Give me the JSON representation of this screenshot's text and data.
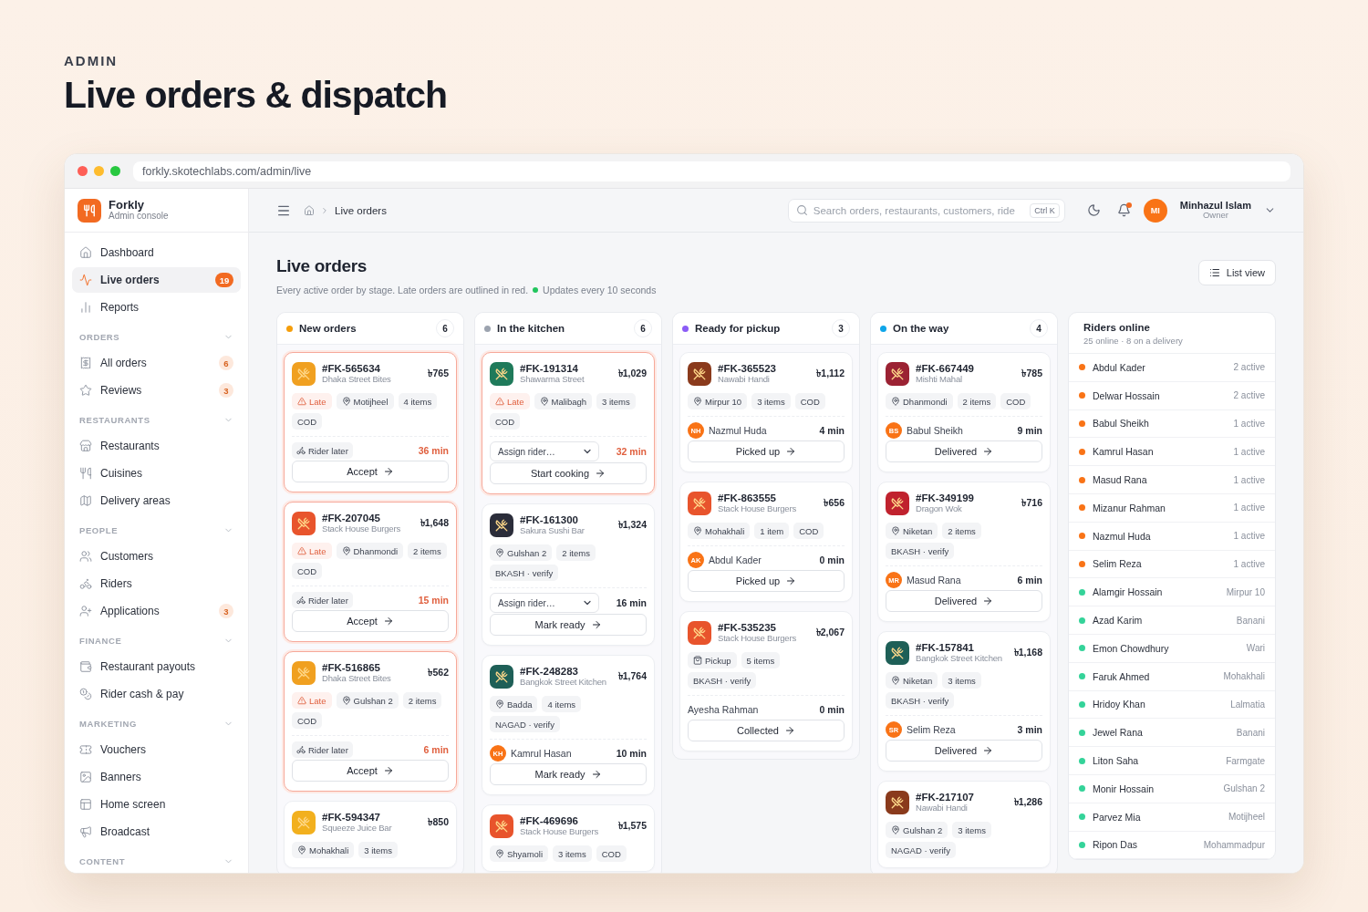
{
  "eyebrow": "ADMIN",
  "headline": "Live orders & dispatch",
  "browser": {
    "url": "forkly.skotechlabs.com/admin/live"
  },
  "sidebar": {
    "brand": {
      "name": "Forkly",
      "subtitle": "Admin console"
    },
    "items": [
      {
        "label": "Dashboard",
        "selected": false
      },
      {
        "label": "Live orders",
        "selected": true,
        "badge": "19"
      },
      {
        "label": "Reports",
        "selected": false
      }
    ],
    "sections": [
      {
        "title": "ORDERS",
        "items": [
          {
            "label": "All orders",
            "selected": false,
            "badge": "6"
          },
          {
            "label": "Reviews",
            "selected": false,
            "badge": "3"
          }
        ]
      },
      {
        "title": "RESTAURANTS",
        "items": [
          {
            "label": "Restaurants",
            "selected": false
          },
          {
            "label": "Cuisines",
            "selected": false
          },
          {
            "label": "Delivery areas",
            "selected": false
          }
        ]
      },
      {
        "title": "PEOPLE",
        "items": [
          {
            "label": "Customers",
            "selected": false
          },
          {
            "label": "Riders",
            "selected": false
          },
          {
            "label": "Applications",
            "selected": false,
            "badge": "3"
          }
        ]
      },
      {
        "title": "FINANCE",
        "items": [
          {
            "label": "Restaurant payouts",
            "selected": false
          },
          {
            "label": "Rider cash & pay",
            "selected": false
          }
        ]
      },
      {
        "title": "MARKETING",
        "items": [
          {
            "label": "Vouchers",
            "selected": false
          },
          {
            "label": "Banners",
            "selected": false
          },
          {
            "label": "Home screen",
            "selected": false
          },
          {
            "label": "Broadcast",
            "selected": false
          }
        ]
      },
      {
        "title": "CONTENT"
      }
    ]
  },
  "topbar": {
    "breadcrumb": "Live orders",
    "search": {
      "placeholder": "Search orders, restaurants, customers, ride",
      "shortcut": "Ctrl K"
    },
    "notifications_unread": true,
    "user": {
      "initials": "MI",
      "name": "Minhazul Islam",
      "role": "Owner"
    }
  },
  "page": {
    "title": "Live orders",
    "subtitle": "Every active order by stage. Late orders are outlined in red.",
    "live_note": "Updates every 10 seconds",
    "view_button": "List view"
  },
  "columns": [
    {
      "title": "New orders",
      "count": "6",
      "color": "#f59e0b",
      "cards": [
        {
          "id": "#FK-565634",
          "restaurant": "Dhaka Street Bites",
          "amount": "৳765",
          "color": "#f0a020",
          "late": true,
          "tags": [
            {
              "kind": "late",
              "label": "Late"
            },
            {
              "kind": "area",
              "label": "Motijheel"
            },
            {
              "kind": "plain",
              "label": "4 items"
            },
            {
              "kind": "plain",
              "label": "COD"
            }
          ],
          "rider": {
            "kind": "later",
            "label": "Rider later"
          },
          "time": "36 min",
          "action": "Accept"
        },
        {
          "id": "#FK-207045",
          "restaurant": "Stack House Burgers",
          "amount": "৳1,648",
          "color": "#e8542c",
          "late": true,
          "tags": [
            {
              "kind": "late",
              "label": "Late"
            },
            {
              "kind": "area",
              "label": "Dhanmondi"
            },
            {
              "kind": "plain",
              "label": "2 items"
            },
            {
              "kind": "plain",
              "label": "COD"
            }
          ],
          "rider": {
            "kind": "later",
            "label": "Rider later"
          },
          "time": "15 min",
          "action": "Accept"
        },
        {
          "id": "#FK-516865",
          "restaurant": "Dhaka Street Bites",
          "amount": "৳562",
          "color": "#f0a020",
          "late": true,
          "tags": [
            {
              "kind": "late",
              "label": "Late"
            },
            {
              "kind": "area",
              "label": "Gulshan 2"
            },
            {
              "kind": "plain",
              "label": "2 items"
            },
            {
              "kind": "plain",
              "label": "COD"
            }
          ],
          "rider": {
            "kind": "later",
            "label": "Rider later"
          },
          "time": "6 min",
          "action": "Accept"
        },
        {
          "id": "#FK-594347",
          "restaurant": "Squeeze Juice Bar",
          "amount": "৳850",
          "color": "#f2b01e",
          "late": false,
          "tags": [
            {
              "kind": "area",
              "label": "Mohakhali"
            },
            {
              "kind": "plain",
              "label": "3 items"
            }
          ]
        }
      ]
    },
    {
      "title": "In the kitchen",
      "count": "6",
      "color": "#9ca3af",
      "cards": [
        {
          "id": "#FK-191314",
          "restaurant": "Shawarma Street",
          "amount": "৳1,029",
          "color": "#1f7a5a",
          "late": true,
          "tags": [
            {
              "kind": "late",
              "label": "Late"
            },
            {
              "kind": "area",
              "label": "Malibagh"
            },
            {
              "kind": "plain",
              "label": "3 items"
            },
            {
              "kind": "plain",
              "label": "COD"
            }
          ],
          "rider": {
            "kind": "select",
            "label": "Assign rider…"
          },
          "time": "32 min",
          "action": "Start cooking"
        },
        {
          "id": "#FK-161300",
          "restaurant": "Sakura Sushi Bar",
          "amount": "৳1,324",
          "color": "#2b2d3a",
          "late": false,
          "tags": [
            {
              "kind": "area",
              "label": "Gulshan 2"
            },
            {
              "kind": "plain",
              "label": "2 items"
            },
            {
              "kind": "plain",
              "label": "BKASH · verify"
            }
          ],
          "rider": {
            "kind": "select",
            "label": "Assign rider…"
          },
          "time": "16 min",
          "action": "Mark ready"
        },
        {
          "id": "#FK-248283",
          "restaurant": "Bangkok Street Kitchen",
          "amount": "৳1,764",
          "color": "#1e5f57",
          "late": false,
          "tags": [
            {
              "kind": "area",
              "label": "Badda"
            },
            {
              "kind": "plain",
              "label": "4 items"
            },
            {
              "kind": "plain",
              "label": "NAGAD · verify"
            }
          ],
          "rider": {
            "kind": "assigned",
            "initials": "KH",
            "name": "Kamrul Hasan"
          },
          "time": "10 min",
          "action": "Mark ready"
        },
        {
          "id": "#FK-469696",
          "restaurant": "Stack House Burgers",
          "amount": "৳1,575",
          "color": "#e8542c",
          "late": false,
          "tags": [
            {
              "kind": "area",
              "label": "Shyamoli"
            },
            {
              "kind": "plain",
              "label": "3 items"
            },
            {
              "kind": "plain",
              "label": "COD"
            }
          ]
        }
      ]
    },
    {
      "title": "Ready for pickup",
      "count": "3",
      "color": "#8b5cf6",
      "cards": [
        {
          "id": "#FK-365523",
          "restaurant": "Nawabi Handi",
          "amount": "৳1,112",
          "color": "#8a3a1c",
          "late": false,
          "tags": [
            {
              "kind": "area",
              "label": "Mirpur 10"
            },
            {
              "kind": "plain",
              "label": "3 items"
            },
            {
              "kind": "plain",
              "label": "COD"
            }
          ],
          "rider": {
            "kind": "assigned",
            "initials": "NH",
            "name": "Nazmul Huda"
          },
          "time": "4 min",
          "action": "Picked up"
        },
        {
          "id": "#FK-863555",
          "restaurant": "Stack House Burgers",
          "amount": "৳656",
          "color": "#e8542c",
          "late": false,
          "tags": [
            {
              "kind": "area",
              "label": "Mohakhali"
            },
            {
              "kind": "plain",
              "label": "1 item"
            },
            {
              "kind": "plain",
              "label": "COD"
            }
          ],
          "rider": {
            "kind": "assigned",
            "initials": "AK",
            "name": "Abdul Kader"
          },
          "time": "0 min",
          "action": "Picked up"
        },
        {
          "id": "#FK-535235",
          "restaurant": "Stack House Burgers",
          "amount": "৳2,067",
          "color": "#e8542c",
          "late": false,
          "tags": [
            {
              "kind": "pickup",
              "label": "Pickup"
            },
            {
              "kind": "plain",
              "label": "5 items"
            },
            {
              "kind": "plain",
              "label": "BKASH · verify"
            }
          ],
          "rider": {
            "kind": "customer",
            "name": "Ayesha Rahman"
          },
          "time": "0 min",
          "action": "Collected"
        }
      ]
    },
    {
      "title": "On the way",
      "count": "4",
      "color": "#0ea5e9",
      "cards": [
        {
          "id": "#FK-667449",
          "restaurant": "Mishti Mahal",
          "amount": "৳785",
          "color": "#9b2233",
          "late": false,
          "tags": [
            {
              "kind": "area",
              "label": "Dhanmondi"
            },
            {
              "kind": "plain",
              "label": "2 items"
            },
            {
              "kind": "plain",
              "label": "COD"
            }
          ],
          "rider": {
            "kind": "assigned",
            "initials": "BS",
            "name": "Babul Sheikh"
          },
          "time": "9 min",
          "action": "Delivered"
        },
        {
          "id": "#FK-349199",
          "restaurant": "Dragon Wok",
          "amount": "৳716",
          "color": "#c0222e",
          "late": false,
          "tags": [
            {
              "kind": "area",
              "label": "Niketan"
            },
            {
              "kind": "plain",
              "label": "2 items"
            },
            {
              "kind": "plain",
              "label": "BKASH · verify"
            }
          ],
          "rider": {
            "kind": "assigned",
            "initials": "MR",
            "name": "Masud Rana"
          },
          "time": "6 min",
          "action": "Delivered"
        },
        {
          "id": "#FK-157841",
          "restaurant": "Bangkok Street Kitchen",
          "amount": "৳1,168",
          "color": "#1e5f57",
          "late": false,
          "tags": [
            {
              "kind": "area",
              "label": "Niketan"
            },
            {
              "kind": "plain",
              "label": "3 items"
            },
            {
              "kind": "plain",
              "label": "BKASH · verify"
            }
          ],
          "rider": {
            "kind": "assigned",
            "initials": "SR",
            "name": "Selim Reza"
          },
          "time": "3 min",
          "action": "Delivered"
        },
        {
          "id": "#FK-217107",
          "restaurant": "Nawabi Handi",
          "amount": "৳1,286",
          "color": "#8a3a1c",
          "late": false,
          "tags": [
            {
              "kind": "area",
              "label": "Gulshan 2"
            },
            {
              "kind": "plain",
              "label": "3 items"
            },
            {
              "kind": "plain",
              "label": "NAGAD · verify"
            }
          ]
        }
      ]
    }
  ],
  "riders": {
    "title": "Riders online",
    "subtitle": "25 online · 8 on a delivery",
    "rows": [
      {
        "name": "Abdul Kader",
        "status": "2 active",
        "color": "#f97316"
      },
      {
        "name": "Delwar Hossain",
        "status": "2 active",
        "color": "#f97316"
      },
      {
        "name": "Babul Sheikh",
        "status": "1 active",
        "color": "#f97316"
      },
      {
        "name": "Kamrul Hasan",
        "status": "1 active",
        "color": "#f97316"
      },
      {
        "name": "Masud Rana",
        "status": "1 active",
        "color": "#f97316"
      },
      {
        "name": "Mizanur Rahman",
        "status": "1 active",
        "color": "#f97316"
      },
      {
        "name": "Nazmul Huda",
        "status": "1 active",
        "color": "#f97316"
      },
      {
        "name": "Selim Reza",
        "status": "1 active",
        "color": "#f97316"
      },
      {
        "name": "Alamgir Hossain",
        "status": "Mirpur 10",
        "color": "#34d399"
      },
      {
        "name": "Azad Karim",
        "status": "Banani",
        "color": "#34d399"
      },
      {
        "name": "Emon Chowdhury",
        "status": "Wari",
        "color": "#34d399"
      },
      {
        "name": "Faruk Ahmed",
        "status": "Mohakhali",
        "color": "#34d399"
      },
      {
        "name": "Hridoy Khan",
        "status": "Lalmatia",
        "color": "#34d399"
      },
      {
        "name": "Jewel Rana",
        "status": "Banani",
        "color": "#34d399"
      },
      {
        "name": "Liton Saha",
        "status": "Farmgate",
        "color": "#34d399"
      },
      {
        "name": "Monir Hossain",
        "status": "Gulshan 2",
        "color": "#34d399"
      },
      {
        "name": "Parvez Mia",
        "status": "Motijheel",
        "color": "#34d399"
      },
      {
        "name": "Ripon Das",
        "status": "Mohammadpur",
        "color": "#34d399"
      }
    ]
  }
}
